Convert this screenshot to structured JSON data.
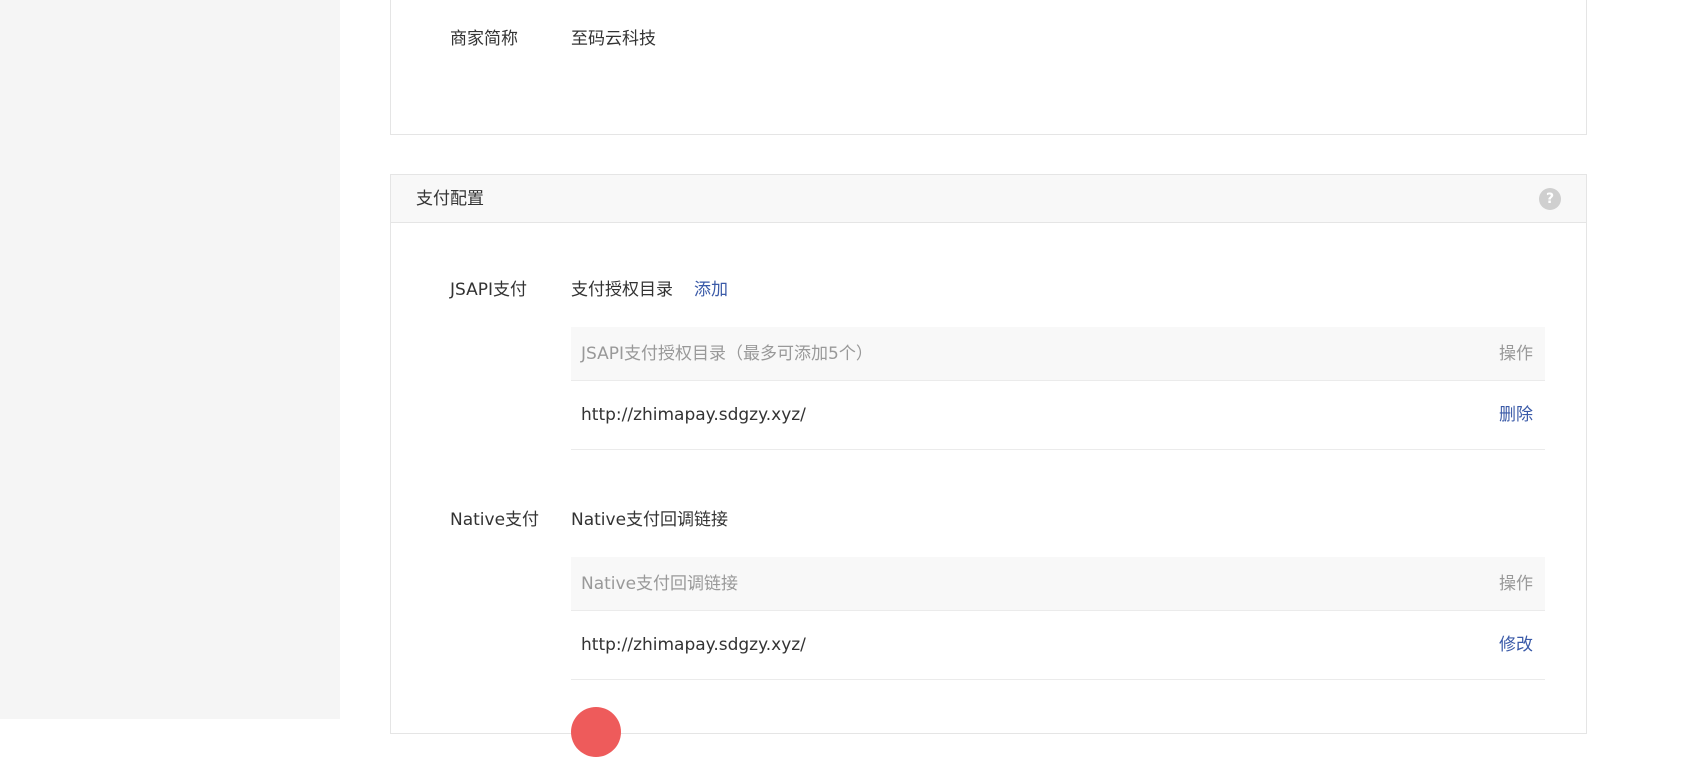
{
  "merchant": {
    "short_name_label": "商家简称",
    "short_name_value": "至码云科技"
  },
  "payment_config": {
    "title": "支付配置",
    "help_icon": "question-circle-icon",
    "help_glyph": "?",
    "jsapi": {
      "label": "JSAPI支付",
      "dir_title": "支付授权目录",
      "add_label": "添加",
      "table": {
        "header_left": "JSAPI支付授权目录（最多可添加5个）",
        "header_right": "操作",
        "rows": [
          {
            "url": "http://zhimapay.sdgzy.xyz/",
            "action": "删除"
          }
        ]
      }
    },
    "native": {
      "label": "Native支付",
      "callback_title": "Native支付回调链接",
      "table": {
        "header_left": "Native支付回调链接",
        "header_right": "操作",
        "rows": [
          {
            "url": "http://zhimapay.sdgzy.xyz/",
            "action": "修改"
          }
        ]
      }
    }
  },
  "colors": {
    "link": "#3a5aa8",
    "muted_text": "#999999",
    "body_text": "#333333",
    "header_bg": "#f8f8f8",
    "border": "#e5e5e5",
    "sidebar_bg": "#f5f5f5",
    "floating_button": "#ee5b5b"
  }
}
